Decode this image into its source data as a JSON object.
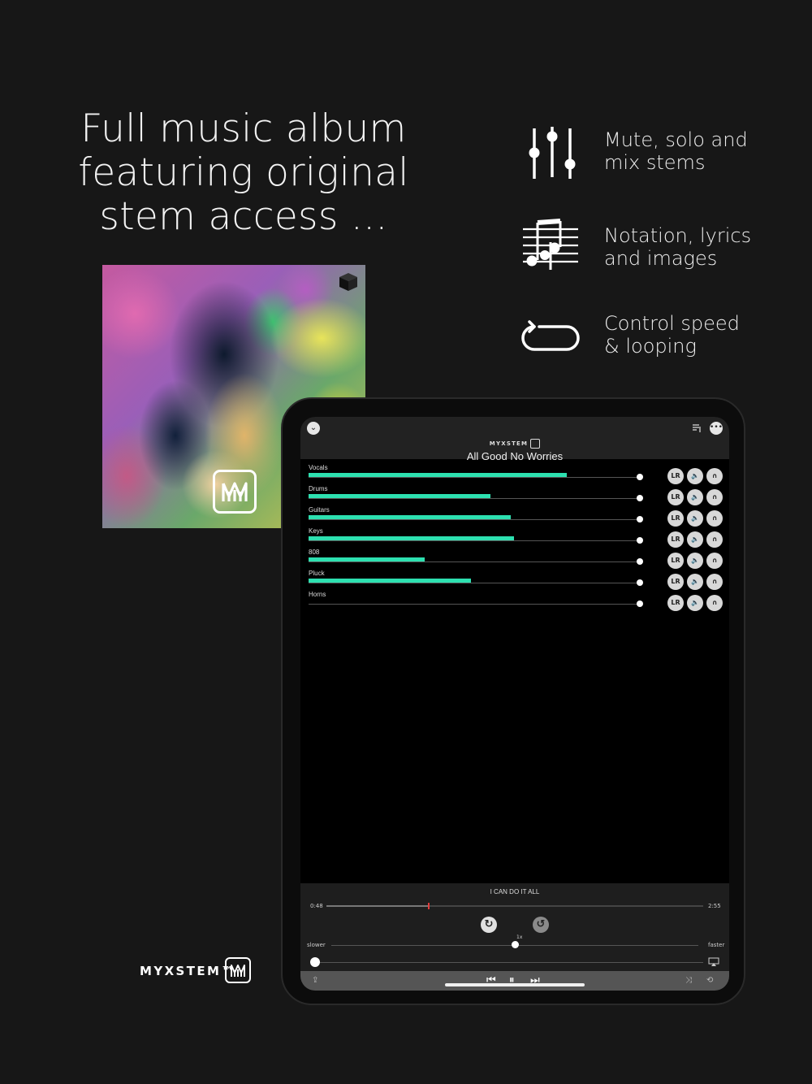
{
  "headline": {
    "line1": "Full music album",
    "line2": "featuring original",
    "line3": "stem access ..."
  },
  "features": [
    {
      "icon": "sliders-icon",
      "line1": "Mute, solo and",
      "line2": "mix stems"
    },
    {
      "icon": "music-notation-icon",
      "line1": "Notation, lyrics",
      "line2": "and images"
    },
    {
      "icon": "loop-icon",
      "line1": "Control speed",
      "line2": "& looping"
    }
  ],
  "brand": {
    "wordmark": "MYXSTEM™",
    "logo_glyph": "M"
  },
  "app": {
    "logo_text": "MYXSTEM",
    "song_title": "All Good No Worries",
    "stems": [
      {
        "name": "Vocals",
        "level": 0.78
      },
      {
        "name": "Drums",
        "level": 0.55
      },
      {
        "name": "Guitars",
        "level": 0.61
      },
      {
        "name": "Keys",
        "level": 0.62
      },
      {
        "name": "808",
        "level": 0.35
      },
      {
        "name": "Pluck",
        "level": 0.49
      },
      {
        "name": "Horns",
        "level": 0.0
      }
    ],
    "stem_buttons": {
      "lr": "LR",
      "mute": "🔈",
      "solo": "∩"
    },
    "section_name": "I CAN DO IT ALL",
    "elapsed": "0:48",
    "duration": "2:55",
    "progress": 0.27,
    "speed_slower": "slower",
    "speed_faster": "faster",
    "speed_value": "1x",
    "speed_position": 0.5,
    "colors": {
      "meter": "#2de0b0",
      "playhead": "#e03c3c"
    }
  }
}
